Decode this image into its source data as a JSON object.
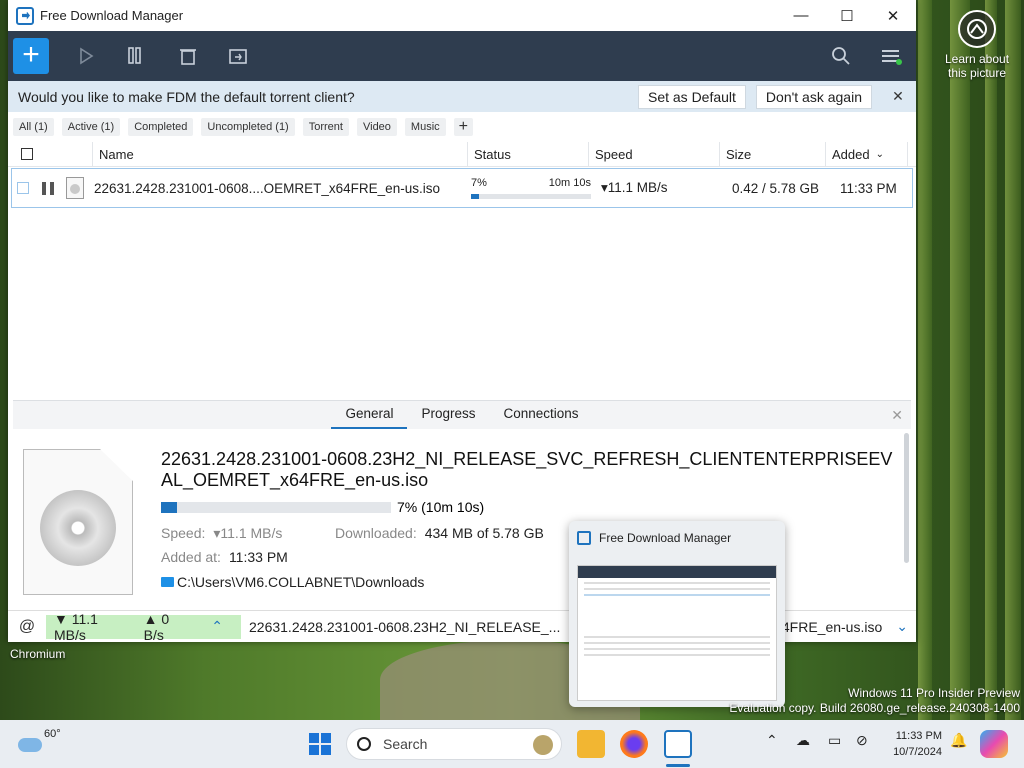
{
  "window": {
    "title": "Free Download Manager"
  },
  "titlebar_controls": {
    "minimize": "—",
    "maximize": "☐",
    "close": "✕"
  },
  "toolbar": {
    "add": "+"
  },
  "infobar": {
    "message": "Would you like to make FDM the default torrent client?",
    "set_default": "Set as Default",
    "dont_ask": "Don't ask again",
    "close": "✕"
  },
  "filters": [
    "All (1)",
    "Active (1)",
    "Completed",
    "Uncompleted (1)",
    "Torrent",
    "Video",
    "Music"
  ],
  "filter_add": "+",
  "columns": {
    "name": "Name",
    "status": "Status",
    "speed": "Speed",
    "size": "Size",
    "added": "Added"
  },
  "download": {
    "name": "22631.2428.231001-0608....OEMRET_x64FRE_en-us.iso",
    "percent": "7%",
    "progress": 0.07,
    "eta": "10m 10s",
    "speed": "▾11.1 MB/s",
    "size": "0.42 / 5.78 GB",
    "added": "11:33 PM"
  },
  "details": {
    "tabs": [
      "General",
      "Progress",
      "Connections"
    ],
    "close": "✕",
    "full_name": "22631.2428.231001-0608.23H2_NI_RELEASE_SVC_REFRESH_CLIENTENTERPRISEEVAL_OEMRET_x64FRE_en-us.iso",
    "progress_text": "7% (10m 10s)",
    "speed_label": "Speed:",
    "speed_value": "▾11.1 MB/s",
    "downloaded_label": "Downloaded:",
    "downloaded_value": "434 MB of 5.78 GB",
    "added_label": "Added at:",
    "added_value": "11:33 PM",
    "folder": "C:\\Users\\VM6.COLLABNET\\Downloads"
  },
  "statusbar": {
    "down": "▼ 11.1 MB/s",
    "up": "▲ 0 B/s",
    "chevron": "⌃",
    "file_left": "22631.2428.231001-0608.23H2_NI_RELEASE_...",
    "file_right": "4FRE_en-us.iso",
    "expand": "⌄"
  },
  "thumbnail": {
    "title": "Free Download Manager"
  },
  "chromium_label": "Chromium",
  "spotlight": {
    "text": "Learn about this picture"
  },
  "watermark": {
    "line1": "Windows 11 Pro Insider Preview",
    "line2": "Evaluation copy. Build 26080.ge_release.240308-1400"
  },
  "taskbar": {
    "temperature": "60°",
    "search": "Search",
    "time": "11:33 PM",
    "date": "10/7/2024"
  }
}
